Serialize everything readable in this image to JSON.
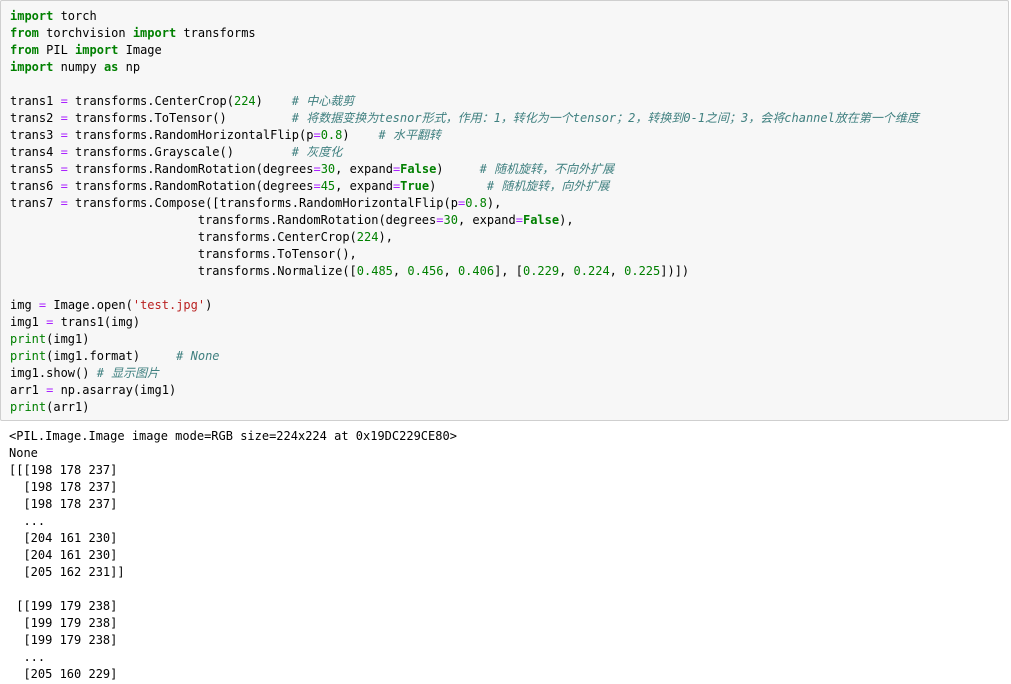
{
  "code": [
    [
      {
        "t": "kw",
        "v": "import"
      },
      {
        "t": "",
        "v": " torch"
      }
    ],
    [
      {
        "t": "kw",
        "v": "from"
      },
      {
        "t": "",
        "v": " torchvision "
      },
      {
        "t": "kw",
        "v": "import"
      },
      {
        "t": "",
        "v": " transforms"
      }
    ],
    [
      {
        "t": "kw",
        "v": "from"
      },
      {
        "t": "",
        "v": " PIL "
      },
      {
        "t": "kw",
        "v": "import"
      },
      {
        "t": "",
        "v": " Image"
      }
    ],
    [
      {
        "t": "kw",
        "v": "import"
      },
      {
        "t": "",
        "v": " numpy "
      },
      {
        "t": "kw",
        "v": "as"
      },
      {
        "t": "",
        "v": " np"
      }
    ],
    [],
    [
      {
        "t": "",
        "v": "trans1 "
      },
      {
        "t": "op",
        "v": "="
      },
      {
        "t": "",
        "v": " transforms.CenterCrop("
      },
      {
        "t": "num",
        "v": "224"
      },
      {
        "t": "",
        "v": ")    "
      },
      {
        "t": "cm",
        "v": "# 中心裁剪"
      }
    ],
    [
      {
        "t": "",
        "v": "trans2 "
      },
      {
        "t": "op",
        "v": "="
      },
      {
        "t": "",
        "v": " transforms.ToTensor()         "
      },
      {
        "t": "cm",
        "v": "# 将数据变换为tesnor形式，作用：1，转化为一个tensor；2，转换到0-1之间；3，会将channel放在第一个维度"
      }
    ],
    [
      {
        "t": "",
        "v": "trans3 "
      },
      {
        "t": "op",
        "v": "="
      },
      {
        "t": "",
        "v": " transforms.RandomHorizontalFlip(p"
      },
      {
        "t": "op",
        "v": "="
      },
      {
        "t": "num",
        "v": "0.8"
      },
      {
        "t": "",
        "v": ")    "
      },
      {
        "t": "cm",
        "v": "# 水平翻转"
      }
    ],
    [
      {
        "t": "",
        "v": "trans4 "
      },
      {
        "t": "op",
        "v": "="
      },
      {
        "t": "",
        "v": " transforms.Grayscale()        "
      },
      {
        "t": "cm",
        "v": "# 灰度化"
      }
    ],
    [
      {
        "t": "",
        "v": "trans5 "
      },
      {
        "t": "op",
        "v": "="
      },
      {
        "t": "",
        "v": " transforms.RandomRotation(degrees"
      },
      {
        "t": "op",
        "v": "="
      },
      {
        "t": "num",
        "v": "30"
      },
      {
        "t": "",
        "v": ", expand"
      },
      {
        "t": "op",
        "v": "="
      },
      {
        "t": "kw",
        "v": "False"
      },
      {
        "t": "",
        "v": ")     "
      },
      {
        "t": "cm",
        "v": "# 随机旋转，不向外扩展"
      }
    ],
    [
      {
        "t": "",
        "v": "trans6 "
      },
      {
        "t": "op",
        "v": "="
      },
      {
        "t": "",
        "v": " transforms.RandomRotation(degrees"
      },
      {
        "t": "op",
        "v": "="
      },
      {
        "t": "num",
        "v": "45"
      },
      {
        "t": "",
        "v": ", expand"
      },
      {
        "t": "op",
        "v": "="
      },
      {
        "t": "kw",
        "v": "True"
      },
      {
        "t": "",
        "v": ")       "
      },
      {
        "t": "cm",
        "v": "# 随机旋转，向外扩展"
      }
    ],
    [
      {
        "t": "",
        "v": "trans7 "
      },
      {
        "t": "op",
        "v": "="
      },
      {
        "t": "",
        "v": " transforms.Compose([transforms.RandomHorizontalFlip(p"
      },
      {
        "t": "op",
        "v": "="
      },
      {
        "t": "num",
        "v": "0.8"
      },
      {
        "t": "",
        "v": "),"
      }
    ],
    [
      {
        "t": "",
        "v": "                          transforms.RandomRotation(degrees"
      },
      {
        "t": "op",
        "v": "="
      },
      {
        "t": "num",
        "v": "30"
      },
      {
        "t": "",
        "v": ", expand"
      },
      {
        "t": "op",
        "v": "="
      },
      {
        "t": "kw",
        "v": "False"
      },
      {
        "t": "",
        "v": "),"
      }
    ],
    [
      {
        "t": "",
        "v": "                          transforms.CenterCrop("
      },
      {
        "t": "num",
        "v": "224"
      },
      {
        "t": "",
        "v": "),"
      }
    ],
    [
      {
        "t": "",
        "v": "                          transforms.ToTensor(),"
      }
    ],
    [
      {
        "t": "",
        "v": "                          transforms.Normalize(["
      },
      {
        "t": "num",
        "v": "0.485"
      },
      {
        "t": "",
        "v": ", "
      },
      {
        "t": "num",
        "v": "0.456"
      },
      {
        "t": "",
        "v": ", "
      },
      {
        "t": "num",
        "v": "0.406"
      },
      {
        "t": "",
        "v": "], ["
      },
      {
        "t": "num",
        "v": "0.229"
      },
      {
        "t": "",
        "v": ", "
      },
      {
        "t": "num",
        "v": "0.224"
      },
      {
        "t": "",
        "v": ", "
      },
      {
        "t": "num",
        "v": "0.225"
      },
      {
        "t": "",
        "v": "])])"
      }
    ],
    [],
    [
      {
        "t": "",
        "v": "img "
      },
      {
        "t": "op",
        "v": "="
      },
      {
        "t": "",
        "v": " Image.open("
      },
      {
        "t": "str",
        "v": "'test.jpg'"
      },
      {
        "t": "",
        "v": ")"
      }
    ],
    [
      {
        "t": "",
        "v": "img1 "
      },
      {
        "t": "op",
        "v": "="
      },
      {
        "t": "",
        "v": " trans1(img)"
      }
    ],
    [
      {
        "t": "bi",
        "v": "print"
      },
      {
        "t": "",
        "v": "(img1)"
      }
    ],
    [
      {
        "t": "bi",
        "v": "print"
      },
      {
        "t": "",
        "v": "(img1.format)     "
      },
      {
        "t": "cm",
        "v": "# None"
      }
    ],
    [
      {
        "t": "",
        "v": "img1.show() "
      },
      {
        "t": "cm",
        "v": "# 显示图片"
      }
    ],
    [
      {
        "t": "",
        "v": "arr1 "
      },
      {
        "t": "op",
        "v": "="
      },
      {
        "t": "",
        "v": " np.asarray(img1)"
      }
    ],
    [
      {
        "t": "bi",
        "v": "print"
      },
      {
        "t": "",
        "v": "(arr1)"
      }
    ]
  ],
  "output": [
    "<PIL.Image.Image image mode=RGB size=224x224 at 0x19DC229CE80>",
    "None",
    "[[[198 178 237]",
    "  [198 178 237]",
    "  [198 178 237]",
    "  ...",
    "  [204 161 230]",
    "  [204 161 230]",
    "  [205 162 231]]",
    "",
    " [[199 179 238]",
    "  [199 179 238]",
    "  [199 179 238]",
    "  ...",
    "  [205 160 229]"
  ]
}
